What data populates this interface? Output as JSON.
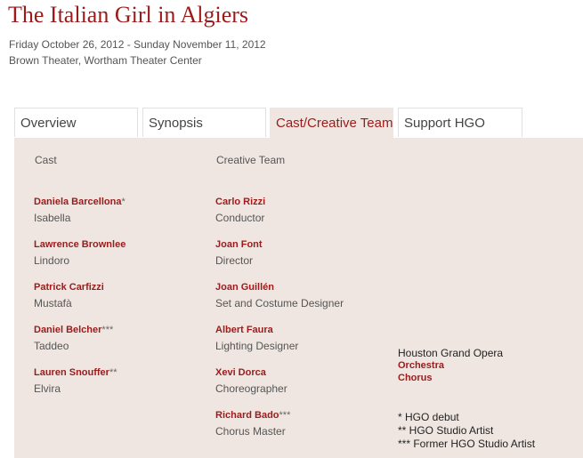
{
  "event": {
    "title": "The Italian Girl in Algiers",
    "dates": "Friday October 26, 2012 - Sunday November 11, 2012",
    "venue": "Brown Theater, Wortham Theater Center"
  },
  "tabs": [
    {
      "label": "Overview",
      "active": false
    },
    {
      "label": "Synopsis",
      "active": false
    },
    {
      "label": "Cast/Creative Team",
      "active": true
    },
    {
      "label": "Support HGO",
      "active": false
    }
  ],
  "columns": {
    "cast": "Cast",
    "creative": "Creative Team"
  },
  "cast": [
    {
      "name": "Daniela Barcellona",
      "mark": "*",
      "role": "Isabella"
    },
    {
      "name": "Lawrence Brownlee",
      "mark": "",
      "role": "Lindoro"
    },
    {
      "name": "Patrick Carfizzi",
      "mark": "",
      "role": "Mustafà"
    },
    {
      "name": "Daniel Belcher",
      "mark": "***",
      "role": "Taddeo"
    },
    {
      "name": "Lauren Snouffer",
      "mark": "**",
      "role": "Elvira"
    }
  ],
  "creative": [
    {
      "name": "Carlo Rizzi",
      "mark": "",
      "role": "Conductor"
    },
    {
      "name": "Joan Font",
      "mark": "",
      "role": "Director"
    },
    {
      "name": "Joan Guillén",
      "mark": "",
      "role": "Set and Costume Designer"
    },
    {
      "name": "Albert Faura",
      "mark": "",
      "role": "Lighting Designer"
    },
    {
      "name": "Xevi Dorca",
      "mark": "",
      "role": "Choreographer"
    },
    {
      "name": "Richard Bado",
      "mark": "***",
      "role": "Chorus Master"
    }
  ],
  "ensembles": {
    "heading": "Houston Grand Opera",
    "orchestra": "Orchestra",
    "chorus": "Chorus"
  },
  "legend": [
    "* HGO debut",
    "** HGO Studio Artist",
    "*** Former HGO Studio Artist"
  ]
}
